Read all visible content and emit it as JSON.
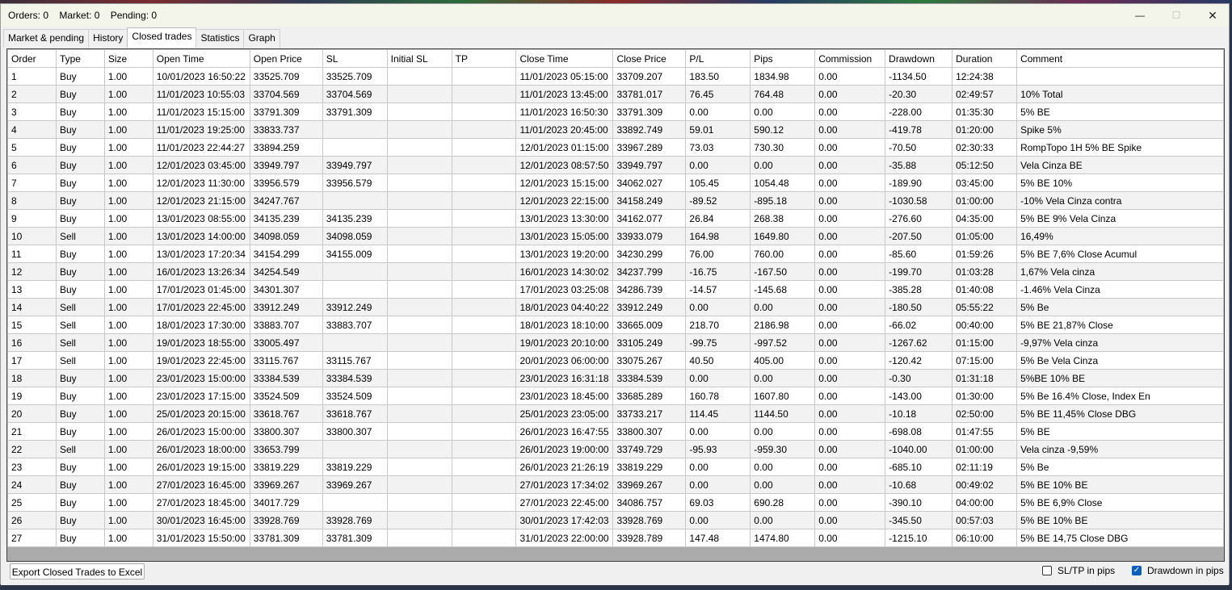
{
  "window": {
    "title": "Orders: 0    Market: 0    Pending: 0",
    "minimize_glyph": "—",
    "maximize_glyph": "☐",
    "close_glyph": "✕"
  },
  "tabs": [
    "Market & pending",
    "History",
    "Closed trades",
    "Statistics",
    "Graph"
  ],
  "active_tab": "Closed trades",
  "table": {
    "columns": [
      "Order",
      "Type",
      "Size",
      "Open Time",
      "Open Price",
      "SL",
      "Initial SL",
      "TP",
      "Close Time",
      "Close Price",
      "P/L",
      "Pips",
      "Commission",
      "Drawdown",
      "Duration",
      "Comment"
    ],
    "rows": [
      [
        "1",
        "Buy",
        "1.00",
        "10/01/2023 16:50:22",
        "33525.709",
        "33525.709",
        "",
        "",
        "11/01/2023 05:15:00",
        "33709.207",
        "183.50",
        "1834.98",
        "0.00",
        "-1134.50",
        "12:24:38",
        ""
      ],
      [
        "2",
        "Buy",
        "1.00",
        "11/01/2023 10:55:03",
        "33704.569",
        "33704.569",
        "",
        "",
        "11/01/2023 13:45:00",
        "33781.017",
        "76.45",
        "764.48",
        "0.00",
        "-20.30",
        "02:49:57",
        "10% Total"
      ],
      [
        "3",
        "Buy",
        "1.00",
        "11/01/2023 15:15:00",
        "33791.309",
        "33791.309",
        "",
        "",
        "11/01/2023 16:50:30",
        "33791.309",
        "0.00",
        "0.00",
        "0.00",
        "-228.00",
        "01:35:30",
        "5%  BE"
      ],
      [
        "4",
        "Buy",
        "1.00",
        "11/01/2023 19:25:00",
        "33833.737",
        "",
        "",
        "",
        "11/01/2023 20:45:00",
        "33892.749",
        "59.01",
        "590.12",
        "0.00",
        "-419.78",
        "01:20:00",
        "Spike 5%"
      ],
      [
        "5",
        "Buy",
        "1.00",
        "11/01/2023 22:44:27",
        "33894.259",
        "",
        "",
        "",
        "12/01/2023 01:15:00",
        "33967.289",
        "73.03",
        "730.30",
        "0.00",
        "-70.50",
        "02:30:33",
        "RompTopo 1H 5% BE Spike"
      ],
      [
        "6",
        "Buy",
        "1.00",
        "12/01/2023 03:45:00",
        "33949.797",
        "33949.797",
        "",
        "",
        "12/01/2023 08:57:50",
        "33949.797",
        "0.00",
        "0.00",
        "0.00",
        "-35.88",
        "05:12:50",
        "Vela Cinza  BE"
      ],
      [
        "7",
        "Buy",
        "1.00",
        "12/01/2023 11:30:00",
        "33956.579",
        "33956.579",
        "",
        "",
        "12/01/2023 15:15:00",
        "34062.027",
        "105.45",
        "1054.48",
        "0.00",
        "-189.90",
        "03:45:00",
        "5% BE 10%"
      ],
      [
        "8",
        "Buy",
        "1.00",
        "12/01/2023 21:15:00",
        "34247.767",
        "",
        "",
        "",
        "12/01/2023 22:15:00",
        "34158.249",
        "-89.52",
        "-895.18",
        "0.00",
        "-1030.58",
        "01:00:00",
        "-10% Vela Cinza contra"
      ],
      [
        "9",
        "Buy",
        "1.00",
        "13/01/2023 08:55:00",
        "34135.239",
        "34135.239",
        "",
        "",
        "13/01/2023 13:30:00",
        "34162.077",
        "26.84",
        "268.38",
        "0.00",
        "-276.60",
        "04:35:00",
        "5% BE 9% Vela Cinza"
      ],
      [
        "10",
        "Sell",
        "1.00",
        "13/01/2023 14:00:00",
        "34098.059",
        "34098.059",
        "",
        "",
        "13/01/2023 15:05:00",
        "33933.079",
        "164.98",
        "1649.80",
        "0.00",
        "-207.50",
        "01:05:00",
        "16,49%"
      ],
      [
        "11",
        "Buy",
        "1.00",
        "13/01/2023 17:20:34",
        "34154.299",
        "34155.009",
        "",
        "",
        "13/01/2023 19:20:00",
        "34230.299",
        "76.00",
        "760.00",
        "0.00",
        "-85.60",
        "01:59:26",
        "5% BE 7,6% Close Acumul"
      ],
      [
        "12",
        "Buy",
        "1.00",
        "16/01/2023 13:26:34",
        "34254.549",
        "",
        "",
        "",
        "16/01/2023 14:30:02",
        "34237.799",
        "-16.75",
        "-167.50",
        "0.00",
        "-199.70",
        "01:03:28",
        "1,67% Vela cinza"
      ],
      [
        "13",
        "Buy",
        "1.00",
        "17/01/2023 01:45:00",
        "34301.307",
        "",
        "",
        "",
        "17/01/2023 03:25:08",
        "34286.739",
        "-14.57",
        "-145.68",
        "0.00",
        "-385.28",
        "01:40:08",
        "-1.46% Vela Cinza"
      ],
      [
        "14",
        "Sell",
        "1.00",
        "17/01/2023 22:45:00",
        "33912.249",
        "33912.249",
        "",
        "",
        "18/01/2023 04:40:22",
        "33912.249",
        "0.00",
        "0.00",
        "0.00",
        "-180.50",
        "05:55:22",
        "5% Be"
      ],
      [
        "15",
        "Sell",
        "1.00",
        "18/01/2023 17:30:00",
        "33883.707",
        "33883.707",
        "",
        "",
        "18/01/2023 18:10:00",
        "33665.009",
        "218.70",
        "2186.98",
        "0.00",
        "-66.02",
        "00:40:00",
        "5% BE 21,87% Close"
      ],
      [
        "16",
        "Sell",
        "1.00",
        "19/01/2023 18:55:00",
        "33005.497",
        "",
        "",
        "",
        "19/01/2023 20:10:00",
        "33105.249",
        "-99.75",
        "-997.52",
        "0.00",
        "-1267.62",
        "01:15:00",
        "-9,97% Vela cinza"
      ],
      [
        "17",
        "Sell",
        "1.00",
        "19/01/2023 22:45:00",
        "33115.767",
        "33115.767",
        "",
        "",
        "20/01/2023 06:00:00",
        "33075.267",
        "40.50",
        "405.00",
        "0.00",
        "-120.42",
        "07:15:00",
        "5% Be Vela Cinza"
      ],
      [
        "18",
        "Buy",
        "1.00",
        "23/01/2023 15:00:00",
        "33384.539",
        "33384.539",
        "",
        "",
        "23/01/2023 16:31:18",
        "33384.539",
        "0.00",
        "0.00",
        "0.00",
        "-0.30",
        "01:31:18",
        "5%BE 10% BE"
      ],
      [
        "19",
        "Buy",
        "1.00",
        "23/01/2023 17:15:00",
        "33524.509",
        "33524.509",
        "",
        "",
        "23/01/2023 18:45:00",
        "33685.289",
        "160.78",
        "1607.80",
        "0.00",
        "-143.00",
        "01:30:00",
        "5% Be 16.4% Close, Index En"
      ],
      [
        "20",
        "Buy",
        "1.00",
        "25/01/2023 20:15:00",
        "33618.767",
        "33618.767",
        "",
        "",
        "25/01/2023 23:05:00",
        "33733.217",
        "114.45",
        "1144.50",
        "0.00",
        "-10.18",
        "02:50:00",
        "5% BE 11,45% Close DBG"
      ],
      [
        "21",
        "Buy",
        "1.00",
        "26/01/2023 15:00:00",
        "33800.307",
        "33800.307",
        "",
        "",
        "26/01/2023 16:47:55",
        "33800.307",
        "0.00",
        "0.00",
        "0.00",
        "-698.08",
        "01:47:55",
        "5% BE"
      ],
      [
        "22",
        "Sell",
        "1.00",
        "26/01/2023 18:00:00",
        "33653.799",
        "",
        "",
        "",
        "26/01/2023 19:00:00",
        "33749.729",
        "-95.93",
        "-959.30",
        "0.00",
        "-1040.00",
        "01:00:00",
        "Vela cinza -9,59%"
      ],
      [
        "23",
        "Buy",
        "1.00",
        "26/01/2023 19:15:00",
        "33819.229",
        "33819.229",
        "",
        "",
        "26/01/2023 21:26:19",
        "33819.229",
        "0.00",
        "0.00",
        "0.00",
        "-685.10",
        "02:11:19",
        "5% Be"
      ],
      [
        "24",
        "Buy",
        "1.00",
        "27/01/2023 16:45:00",
        "33969.267",
        "33969.267",
        "",
        "",
        "27/01/2023 17:34:02",
        "33969.267",
        "0.00",
        "0.00",
        "0.00",
        "-10.68",
        "00:49:02",
        "5% BE 10% BE"
      ],
      [
        "25",
        "Buy",
        "1.00",
        "27/01/2023 18:45:00",
        "34017.729",
        "",
        "",
        "",
        "27/01/2023 22:45:00",
        "34086.757",
        "69.03",
        "690.28",
        "0.00",
        "-390.10",
        "04:00:00",
        "5% BE 6,9% Close"
      ],
      [
        "26",
        "Buy",
        "1.00",
        "30/01/2023 16:45:00",
        "33928.769",
        "33928.769",
        "",
        "",
        "30/01/2023 17:42:03",
        "33928.769",
        "0.00",
        "0.00",
        "0.00",
        "-345.50",
        "00:57:03",
        "5% BE 10% BE"
      ],
      [
        "27",
        "Buy",
        "1.00",
        "31/01/2023 15:50:00",
        "33781.309",
        "33781.309",
        "",
        "",
        "31/01/2023 22:00:00",
        "33928.789",
        "147.48",
        "1474.80",
        "0.00",
        "-1215.10",
        "06:10:00",
        "5% BE 14,75 Close DBG"
      ]
    ]
  },
  "bottom": {
    "export_label": "Export Closed Trades to Excel",
    "sltp_label": "SL/TP in pips",
    "sltp_checked": false,
    "drawdown_label": "Drawdown in pips",
    "drawdown_checked": true,
    "check_glyph": "✓"
  },
  "colors": {
    "accent": "#0a5fc0",
    "titlebar": "#f3f5ea",
    "grid_empty": "#ababab"
  }
}
